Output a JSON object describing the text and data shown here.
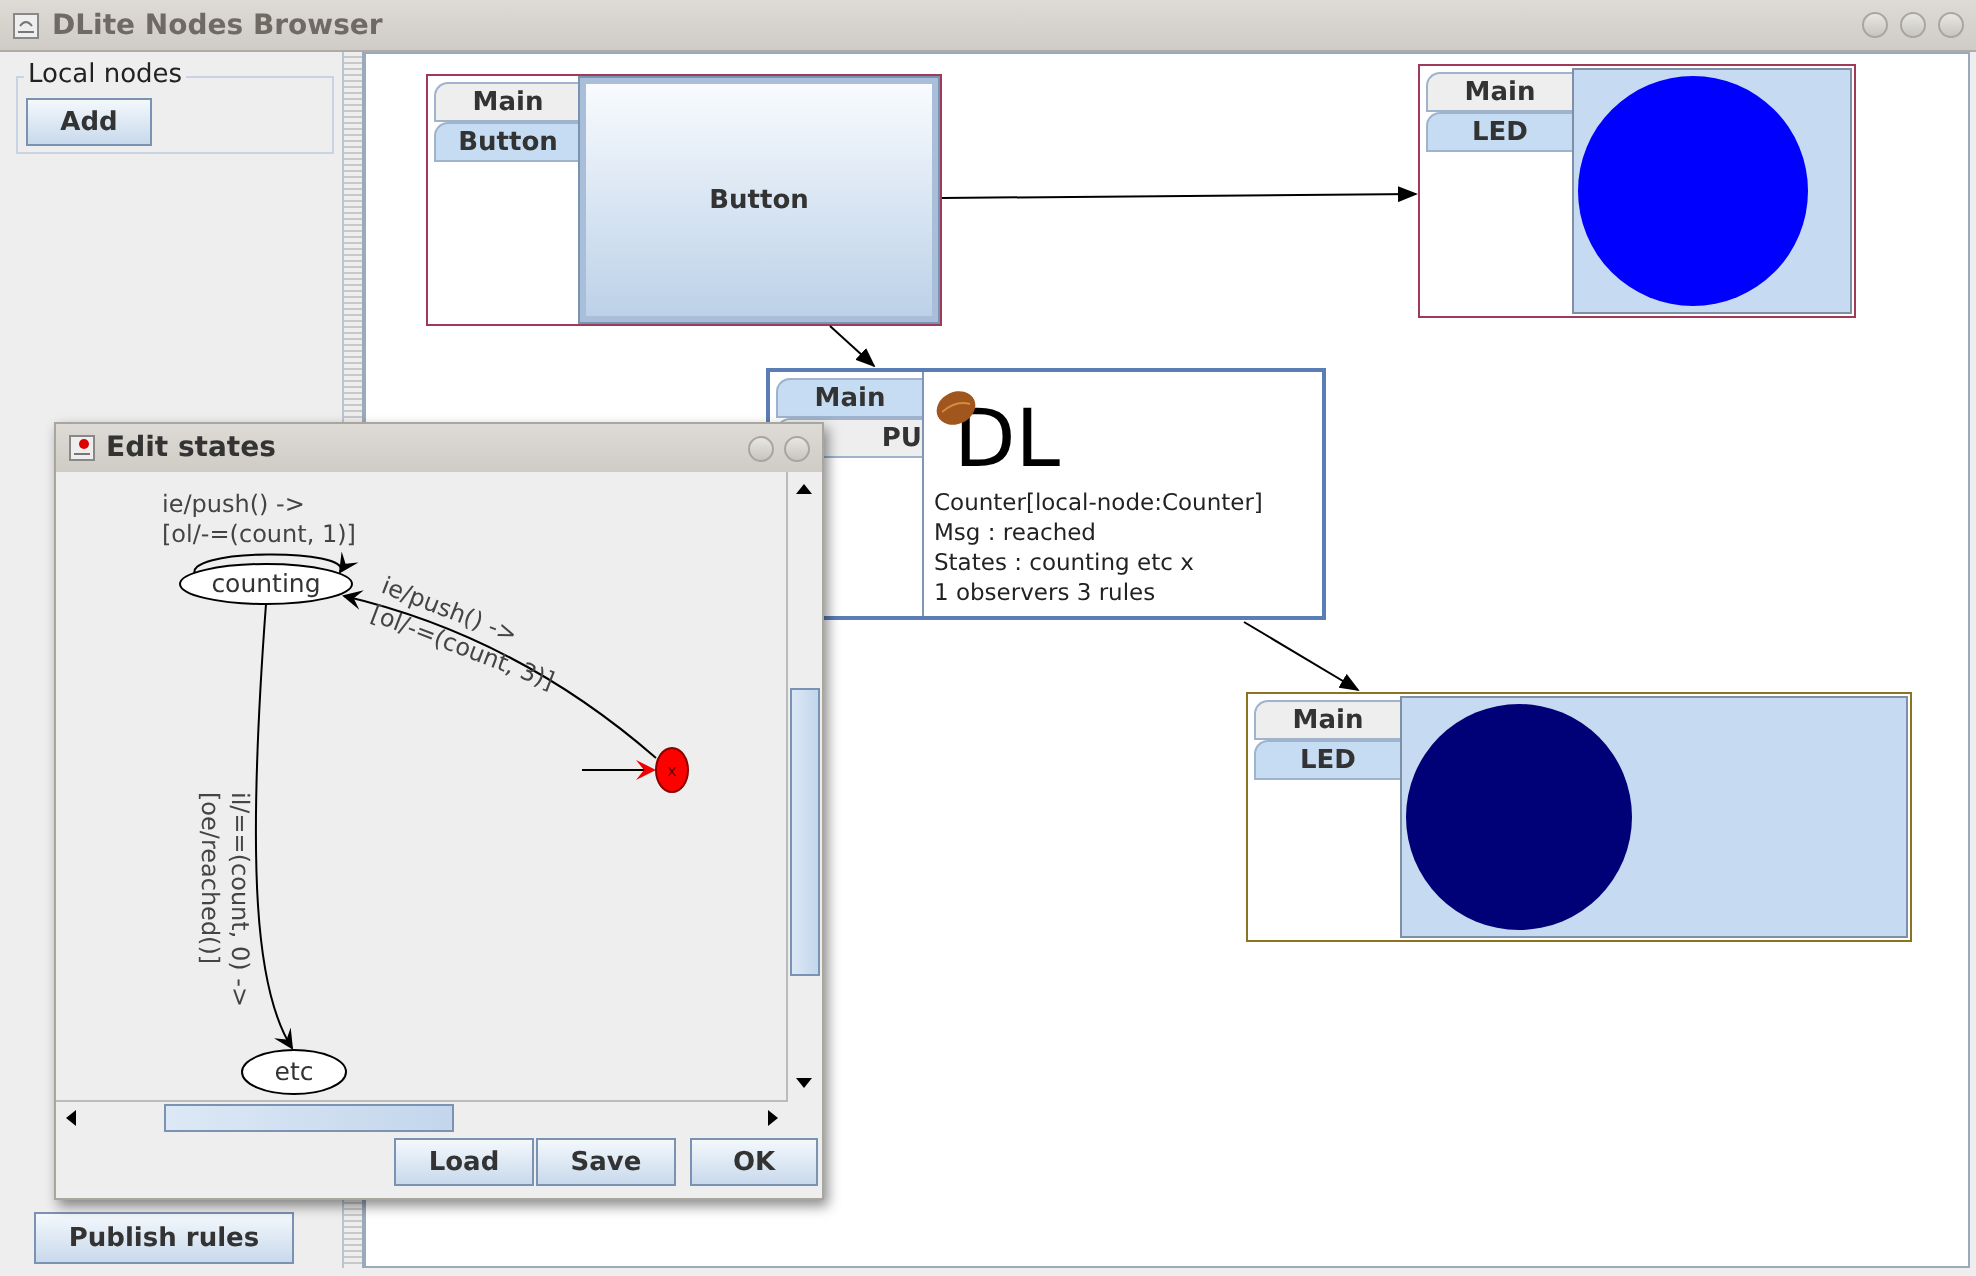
{
  "window": {
    "title": "DLite Nodes Browser"
  },
  "sidebar": {
    "group_title": "Local nodes",
    "add_button": "Add",
    "publish_button": "Publish rules"
  },
  "nodes": [
    {
      "kind": "button",
      "tabs": [
        {
          "label": "Main",
          "selected": false
        },
        {
          "label": "Button",
          "selected": true
        }
      ],
      "button_label": "Button"
    },
    {
      "kind": "led",
      "color": "#0000ff",
      "tabs": [
        {
          "label": "Main",
          "selected": false
        },
        {
          "label": "LED",
          "selected": true
        }
      ]
    },
    {
      "kind": "cpu",
      "tabs": [
        {
          "label": "Main",
          "selected": true
        },
        {
          "label": "PU",
          "selected": false
        }
      ],
      "logo": "DL",
      "lines": [
        "Counter[local-node:Counter]",
        "Msg : reached",
        "States : counting etc x",
        "1 observers 3 rules"
      ]
    },
    {
      "kind": "led",
      "color": "#000077",
      "tabs": [
        {
          "label": "Main",
          "selected": false
        },
        {
          "label": "LED",
          "selected": true
        }
      ]
    }
  ],
  "dialog": {
    "title": "Edit states",
    "states": [
      {
        "kind": "state",
        "label": "counting"
      },
      {
        "kind": "state",
        "label": "etc"
      },
      {
        "kind": "initial",
        "label": "x"
      }
    ],
    "transitions": [
      {
        "lines": [
          "ie/push() ->",
          "[ol/-=(count, 1)]"
        ]
      },
      {
        "lines": [
          "ie/push() ->",
          "[ol/-=(count, 3)]"
        ]
      },
      {
        "lines": [
          "il/==(count, 0) ->",
          "[oe/reached()]"
        ]
      }
    ],
    "buttons": [
      "Load",
      "Save",
      "OK"
    ]
  }
}
